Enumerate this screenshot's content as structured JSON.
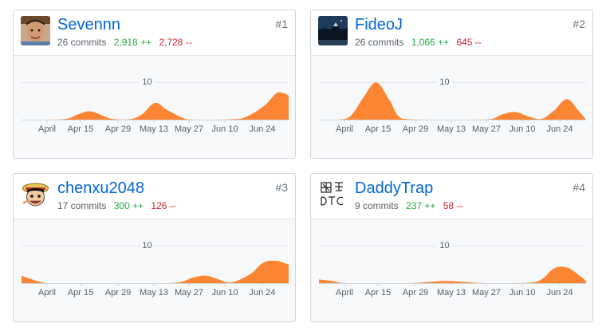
{
  "contributors": [
    {
      "rank": "#1",
      "name": "Sevennn",
      "commits": "26 commits",
      "additions": "2,918 ++",
      "deletions": "2,728 --",
      "avatar_icon": "avatar-photo-man",
      "chart_data": {
        "type": "area",
        "x_ticks": [
          "April",
          "Apr 15",
          "Apr 29",
          "May 13",
          "May 27",
          "Jun 10",
          "Jun 24"
        ],
        "y_tick": "10",
        "ylim": [
          0,
          15
        ],
        "x": [
          0,
          7,
          14,
          18,
          22,
          28,
          34,
          38,
          42,
          46,
          52,
          56,
          60,
          66,
          70,
          76,
          80,
          82,
          84
        ],
        "values": [
          0,
          0,
          0.2,
          1.5,
          2.2,
          0.3,
          0.1,
          1.5,
          4.5,
          2.5,
          0.1,
          0,
          0,
          0.1,
          0.5,
          3.5,
          7.0,
          7.2,
          6.5
        ]
      }
    },
    {
      "rank": "#2",
      "name": "FideoJ",
      "commits": "26 commits",
      "additions": "1,066 ++",
      "deletions": "645 --",
      "avatar_icon": "avatar-photo-landscape",
      "chart_data": {
        "type": "area",
        "x_ticks": [
          "April",
          "Apr 15",
          "Apr 29",
          "May 13",
          "May 27",
          "Jun 10",
          "Jun 24"
        ],
        "y_tick": "10",
        "ylim": [
          0,
          15
        ],
        "x": [
          0,
          6,
          10,
          14,
          18,
          22,
          26,
          34,
          40,
          48,
          54,
          58,
          62,
          66,
          70,
          74,
          78,
          82,
          84
        ],
        "values": [
          0,
          0,
          1.0,
          6.0,
          10.0,
          5.5,
          0.3,
          0,
          0,
          0,
          0.1,
          1.5,
          2.0,
          0.8,
          0.2,
          2.5,
          5.5,
          2.0,
          0
        ]
      }
    },
    {
      "rank": "#3",
      "name": "chenxu2048",
      "commits": "17 commits",
      "additions": "300 ++",
      "deletions": "126 --",
      "avatar_icon": "avatar-cartoon-pirate",
      "chart_data": {
        "type": "area",
        "x_ticks": [
          "April",
          "Apr 15",
          "Apr 29",
          "May 13",
          "May 27",
          "Jun 10",
          "Jun 24"
        ],
        "y_tick": "10",
        "ylim": [
          0,
          15
        ],
        "x": [
          0,
          4,
          8,
          14,
          30,
          44,
          50,
          54,
          58,
          62,
          66,
          72,
          76,
          80,
          84
        ],
        "values": [
          2.0,
          0.8,
          0,
          0,
          0,
          0,
          0.3,
          1.5,
          2.0,
          1.0,
          0.2,
          2.5,
          5.5,
          6.0,
          5.0
        ]
      }
    },
    {
      "rank": "#4",
      "name": "DaddyTrap",
      "commits": "9 commits",
      "additions": "237 ++",
      "deletions": "58 --",
      "avatar_icon": "avatar-drawing-dtc",
      "chart_data": {
        "type": "area",
        "x_ticks": [
          "April",
          "Apr 15",
          "Apr 29",
          "May 13",
          "May 27",
          "Jun 10",
          "Jun 24"
        ],
        "y_tick": "10",
        "ylim": [
          0,
          15
        ],
        "x": [
          0,
          4,
          8,
          14,
          28,
          34,
          40,
          46,
          52,
          60,
          66,
          70,
          74,
          78,
          82,
          84
        ],
        "values": [
          1.0,
          0.6,
          0,
          0,
          0,
          0.3,
          0.6,
          0.3,
          0,
          0,
          0.1,
          1.0,
          4.0,
          4.2,
          2.0,
          0.5
        ]
      }
    }
  ],
  "colors": {
    "area": "#fb8532",
    "grid": "#e1e4e8",
    "axis_text": "#586069",
    "link": "#0366d6"
  }
}
